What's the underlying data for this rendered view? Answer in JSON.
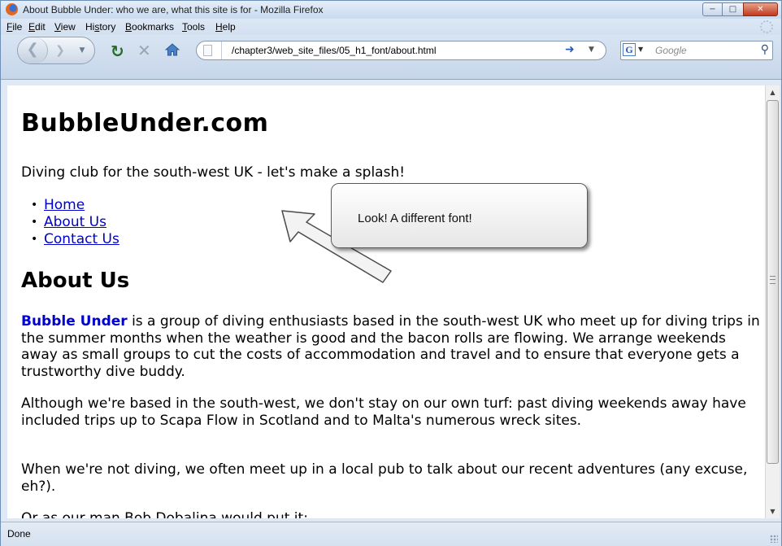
{
  "window": {
    "title": "About Bubble Under: who we are, what this site is for - Mozilla Firefox",
    "minimize": "−",
    "maximize": "□",
    "close": "✕"
  },
  "menubar": {
    "items": [
      {
        "mnemonic": "F",
        "rest": "ile"
      },
      {
        "mnemonic": "E",
        "rest": "dit"
      },
      {
        "mnemonic": "V",
        "rest": "iew"
      },
      {
        "pre": "Hi",
        "mnemonic": "s",
        "rest": "tory"
      },
      {
        "mnemonic": "B",
        "rest": "ookmarks"
      },
      {
        "mnemonic": "T",
        "rest": "ools"
      },
      {
        "mnemonic": "H",
        "rest": "elp"
      }
    ]
  },
  "toolbar": {
    "url": "/chapter3/web_site_files/05_h1_font/about.html",
    "search_placeholder": "Google",
    "icons": [
      "back-icon",
      "forward-icon",
      "reload-icon",
      "stop-icon",
      "home-icon",
      "go-arrow-icon",
      "search-icon"
    ]
  },
  "page": {
    "site_title": "BubbleUnder.com",
    "tagline": "Diving club for the south-west UK - let's make a splash!",
    "nav": [
      "Home",
      "About Us",
      "Contact Us"
    ],
    "heading": "About Us",
    "p1_link": "Bubble Under",
    "p1_rest": " is a group of diving enthusiasts based in the south-west UK who meet up for diving trips in the summer months when the weather is good and the bacon rolls are flowing. We arrange weekends away as small groups to cut the costs of accommodation and travel and to ensure that everyone gets a trustworthy dive buddy.",
    "p2": "Although we're based in the south-west, we don't stay on our own turf: past diving weekends away have included trips up to Scapa Flow in Scotland and to Malta's numerous wreck sites.",
    "p3": "When we're not diving, we often meet up in a local pub to talk about our recent adventures (any excuse, eh?).",
    "p4": "Or as our man Bob Dobalina would put it:"
  },
  "callout": {
    "text": "Look! A different font!"
  },
  "status": {
    "text": "Done"
  }
}
